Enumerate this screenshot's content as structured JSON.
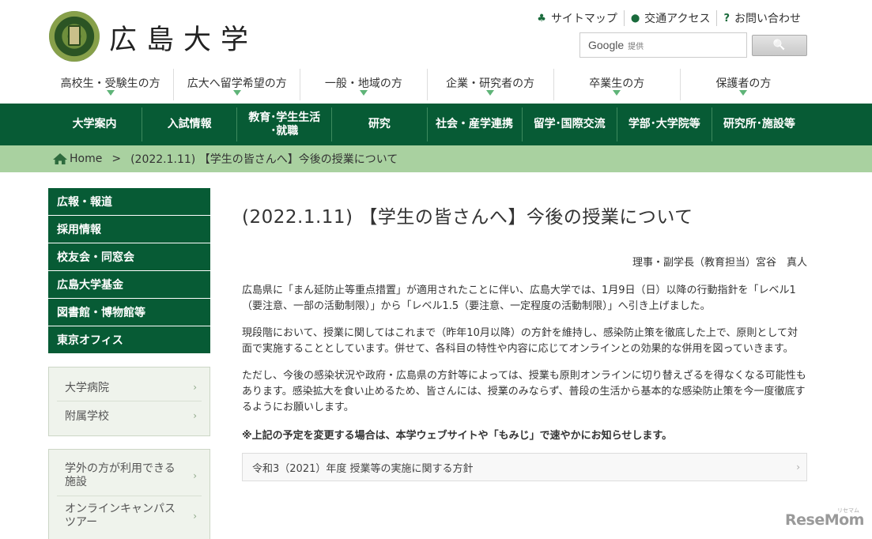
{
  "header": {
    "site_title": "広島大学",
    "util_links": [
      {
        "icon": "sitemap-icon",
        "glyph": "♣",
        "label": "サイトマップ"
      },
      {
        "icon": "location-pin-icon",
        "glyph": "⬤",
        "label": "交通アクセス"
      },
      {
        "icon": "question-icon",
        "glyph": "?",
        "label": "お問い合わせ"
      }
    ],
    "search": {
      "google": "Google",
      "provided": "提供",
      "button_glyph": "🔍"
    }
  },
  "audience_nav": [
    "高校生・受験生の方",
    "広大へ留学希望の方",
    "一般・地域の方",
    "企業・研究者の方",
    "卒業生の方",
    "保護者の方"
  ],
  "global_nav": [
    "大学案内",
    "入試情報",
    "教育･学生生活\n･就職",
    "研究",
    "社会・産学連携",
    "留学･国際交流",
    "学部･大学院等",
    "研究所･施設等"
  ],
  "breadcrumb": {
    "home": "Home",
    "separator": ">",
    "current": "(2022.1.11) 【学生の皆さんへ】今後の授業について"
  },
  "sidebar": {
    "green_items": [
      "広報・報道",
      "採用情報",
      "校友会・同窓会",
      "広島大学基金",
      "図書館・博物館等",
      "東京オフィス"
    ],
    "box1": [
      "大学病院",
      "附属学校"
    ],
    "box2": [
      "学外の方が利用できる施設",
      "オンラインキャンパスツアー"
    ],
    "chevron": "›"
  },
  "article": {
    "title": "(2022.1.11) 【学生の皆さんへ】今後の授業について",
    "author": "理事・副学長（教育担当）宮谷　真人",
    "paragraphs": [
      "広島県に「まん延防止等重点措置」が適用されたことに伴い、広島大学では、1月9日（日）以降の行動指針を「レベル1（要注意、一部の活動制限）」から「レベル1.5（要注意、一定程度の活動制限）」へ引き上げました。",
      "現段階において、授業に関してはこれまで（昨年10月以降）の方針を維持し、感染防止策を徹底した上で、原則として対面で実施することとしています。併せて、各科目の特性や内容に応じてオンラインとの効果的な併用を図っていきます。",
      "ただし、今後の感染状況や政府・広島県の方針等によっては、授業も原則オンラインに切り替えざるを得なくなる可能性もあります。感染拡大を食い止めるため、皆さんには、授業のみならず、普段の生活から基本的な感染防止策を今一度徹底するようにお願いします。"
    ],
    "note": "※上記の予定を変更する場合は、本学ウェブサイトや「もみじ」で速やかにお知らせします。",
    "accordion": "令和3（2021）年度 授業等の実施に関する方針"
  },
  "watermark": {
    "brand": "ReseMom",
    "small": "リセマム"
  }
}
